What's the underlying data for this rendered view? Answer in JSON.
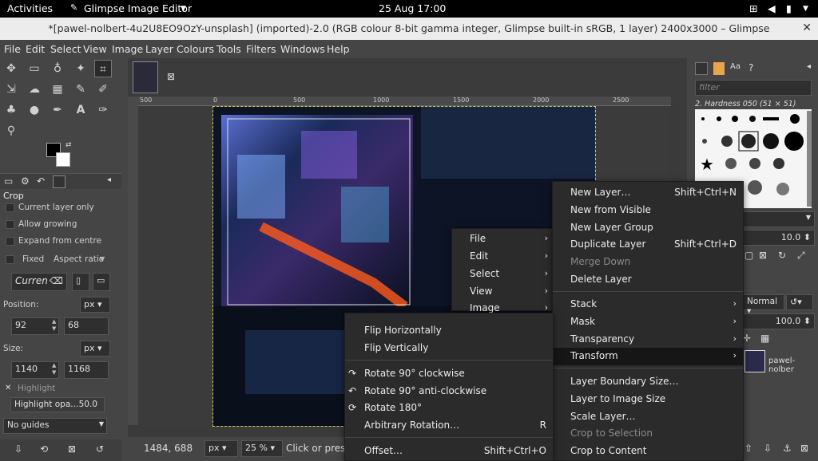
{
  "topbar": {
    "activities": "Activities",
    "app": "Glimpse Image Editor",
    "datetime": "25 Aug  17:00"
  },
  "window": {
    "title": "*[pawel-nolbert-4u2U8EO9OzY-unsplash] (imported)-2.0 (RGB colour 8-bit gamma integer, Glimpse built-in sRGB, 1 layer) 2400x3000 – Glimpse"
  },
  "menubar": [
    "File",
    "Edit",
    "Select",
    "View",
    "Image",
    "Layer",
    "Colours",
    "Tools",
    "Filters",
    "Windows",
    "Help"
  ],
  "tool_options": {
    "title": "Crop",
    "current_layer_only": "Current layer only",
    "allow_growing": "Allow growing",
    "expand_from_centre": "Expand from centre",
    "fixed": "Fixed",
    "aspect_ratio": "Aspect ratio",
    "current": "Curren",
    "position_label": "Position:",
    "position_unit": "px",
    "pos_x": "92",
    "pos_y": "68",
    "size_label": "Size:",
    "size_unit": "px",
    "size_w": "1140",
    "size_h": "1168",
    "highlight": "Highlight",
    "highlight_opacity_label": "Highlight opa...",
    "highlight_opacity_value": "50.0",
    "guides": "No guides"
  },
  "ruler": [
    "500",
    "0",
    "500",
    "1000",
    "1500",
    "2000",
    "2500"
  ],
  "status": {
    "coords": "1484, 688",
    "unit": "px",
    "zoom": "25 %",
    "message": "Click or pres"
  },
  "dock": {
    "filter_placeholder": "filter",
    "brush_name": "2. Hardness 050 (51 × 51)",
    "spacing": "10.0",
    "mode": "Normal",
    "opacity": "100.0",
    "layer_name": "pawel-nolber"
  },
  "menu_main": [
    "File",
    "Edit",
    "Select",
    "View",
    "Image"
  ],
  "menu_layer": {
    "items": [
      {
        "label": "New Layer…",
        "shortcut": "Shift+Ctrl+N"
      },
      {
        "label": "New from Visible",
        "shortcut": ""
      },
      {
        "label": "New Layer Group",
        "shortcut": ""
      },
      {
        "label": "Duplicate Layer",
        "shortcut": "Shift+Ctrl+D"
      },
      {
        "label": "Merge Down",
        "shortcut": ""
      },
      {
        "label": "Delete Layer",
        "shortcut": ""
      },
      {
        "label": "Stack",
        "shortcut": ""
      },
      {
        "label": "Mask",
        "shortcut": ""
      },
      {
        "label": "Transparency",
        "shortcut": ""
      },
      {
        "label": "Transform",
        "shortcut": ""
      },
      {
        "label": "Layer Boundary Size…",
        "shortcut": ""
      },
      {
        "label": "Layer to Image Size",
        "shortcut": ""
      },
      {
        "label": "Scale Layer…",
        "shortcut": ""
      },
      {
        "label": "Crop to Selection",
        "shortcut": ""
      },
      {
        "label": "Crop to Content",
        "shortcut": ""
      }
    ]
  },
  "menu_transform": {
    "items": [
      {
        "label": "Flip Horizontally",
        "shortcut": ""
      },
      {
        "label": "Flip Vertically",
        "shortcut": ""
      },
      {
        "label": "Rotate 90° clockwise",
        "shortcut": ""
      },
      {
        "label": "Rotate 90° anti-clockwise",
        "shortcut": ""
      },
      {
        "label": "Rotate 180°",
        "shortcut": ""
      },
      {
        "label": "Arbitrary Rotation…",
        "shortcut": "R"
      },
      {
        "label": "Offset…",
        "shortcut": "Shift+Ctrl+O"
      }
    ]
  }
}
